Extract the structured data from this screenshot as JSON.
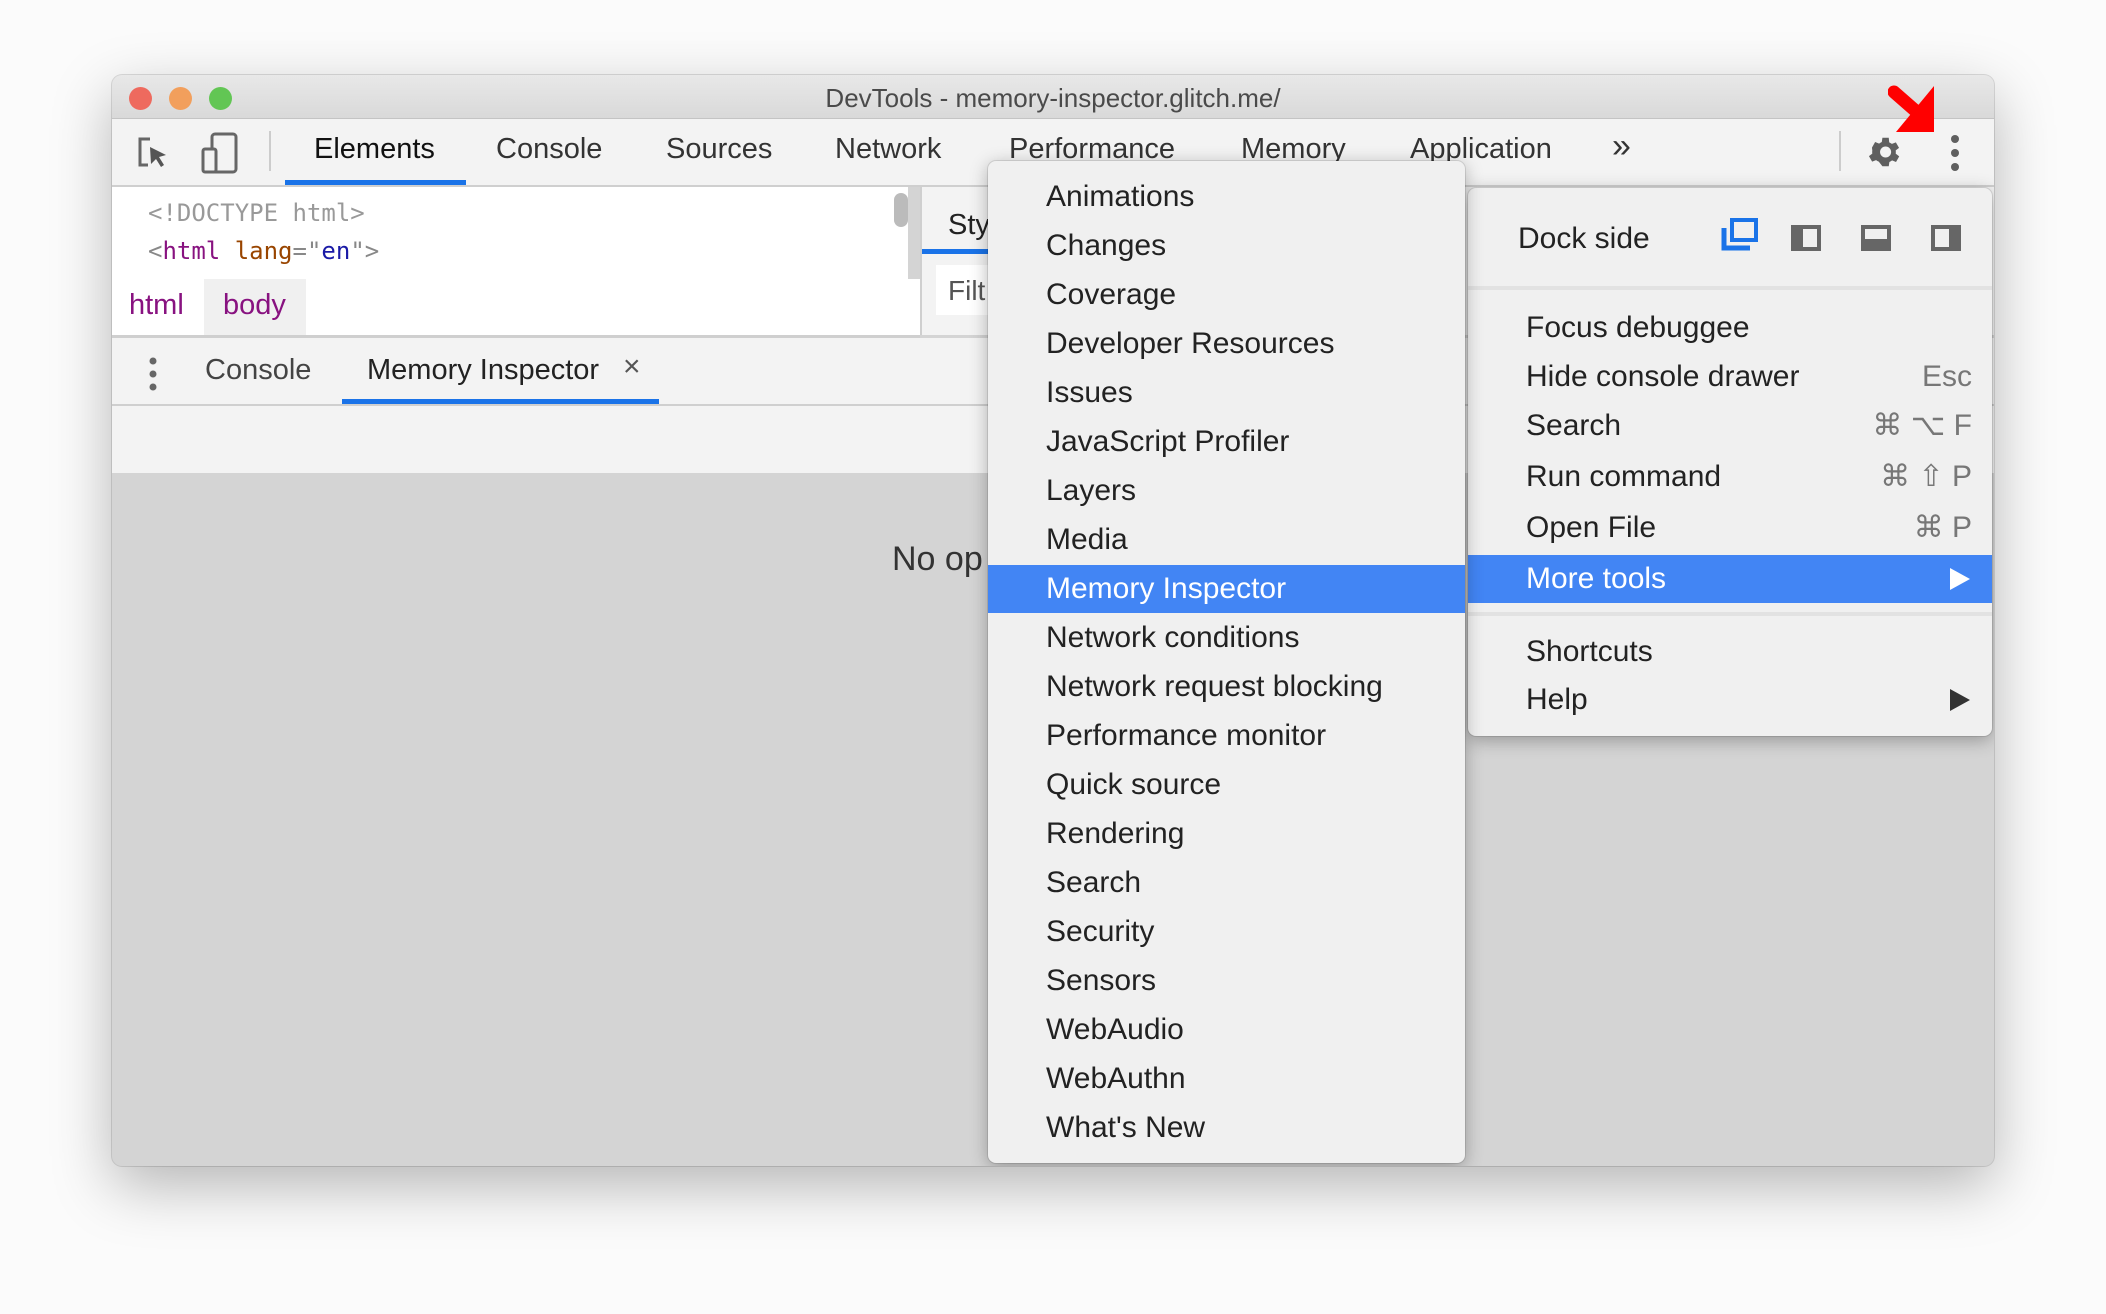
{
  "window": {
    "title": "DevTools - memory-inspector.glitch.me/"
  },
  "colors": {
    "accent": "#1a73e8",
    "menu_highlight": "#4285f4",
    "traffic_red": "#ee6a5e",
    "traffic_yellow": "#f29f5c",
    "traffic_green": "#62c654",
    "annotation_arrow": "#ff0000"
  },
  "toolbar": {
    "icons": [
      "inspect-element-icon",
      "device-toolbar-icon",
      "settings-gear-icon",
      "more-options-kebab-icon"
    ],
    "tabs": [
      {
        "label": "Elements",
        "active": true
      },
      {
        "label": "Console"
      },
      {
        "label": "Sources"
      },
      {
        "label": "Network"
      },
      {
        "label": "Performance"
      },
      {
        "label": "Memory"
      },
      {
        "label": "Application"
      }
    ],
    "overflow": "»"
  },
  "dom": {
    "doctype": "<!DOCTYPE html>",
    "html_open": "<",
    "html_tag": "html",
    "attr_name": "lang",
    "eq": "=\"",
    "attr_value": "en",
    "close": "\">"
  },
  "breadcrumbs": [
    "html",
    "body"
  ],
  "styles": {
    "tab": "Sty",
    "filter": "Filt"
  },
  "drawer": {
    "tabs": [
      {
        "label": "Console"
      },
      {
        "label": "Memory Inspector",
        "active": true,
        "closable": true
      }
    ],
    "close": "×",
    "empty_text": "No op"
  },
  "main_menu": {
    "dock_side": {
      "label": "Dock side",
      "options": [
        "undock",
        "dock-left",
        "dock-bottom",
        "dock-right"
      ],
      "selected": "undock"
    },
    "group1": [
      {
        "label": "Focus debuggee",
        "shortcut": ""
      },
      {
        "label": "Hide console drawer",
        "shortcut": "Esc"
      },
      {
        "label": "Search",
        "shortcut": "⌘ ⌥ F"
      },
      {
        "label": "Run command",
        "shortcut": "⌘ ⇧ P"
      },
      {
        "label": "Open File",
        "shortcut": "⌘ P"
      },
      {
        "label": "More tools",
        "submenu": true,
        "selected": true
      }
    ],
    "group2": [
      {
        "label": "Shortcuts"
      },
      {
        "label": "Help",
        "submenu": true
      }
    ]
  },
  "more_tools": {
    "items": [
      "Animations",
      "Changes",
      "Coverage",
      "Developer Resources",
      "Issues",
      "JavaScript Profiler",
      "Layers",
      "Media",
      "Memory Inspector",
      "Network conditions",
      "Network request blocking",
      "Performance monitor",
      "Quick source",
      "Rendering",
      "Search",
      "Security",
      "Sensors",
      "WebAudio",
      "WebAuthn",
      "What's New"
    ],
    "selected": "Memory Inspector"
  }
}
